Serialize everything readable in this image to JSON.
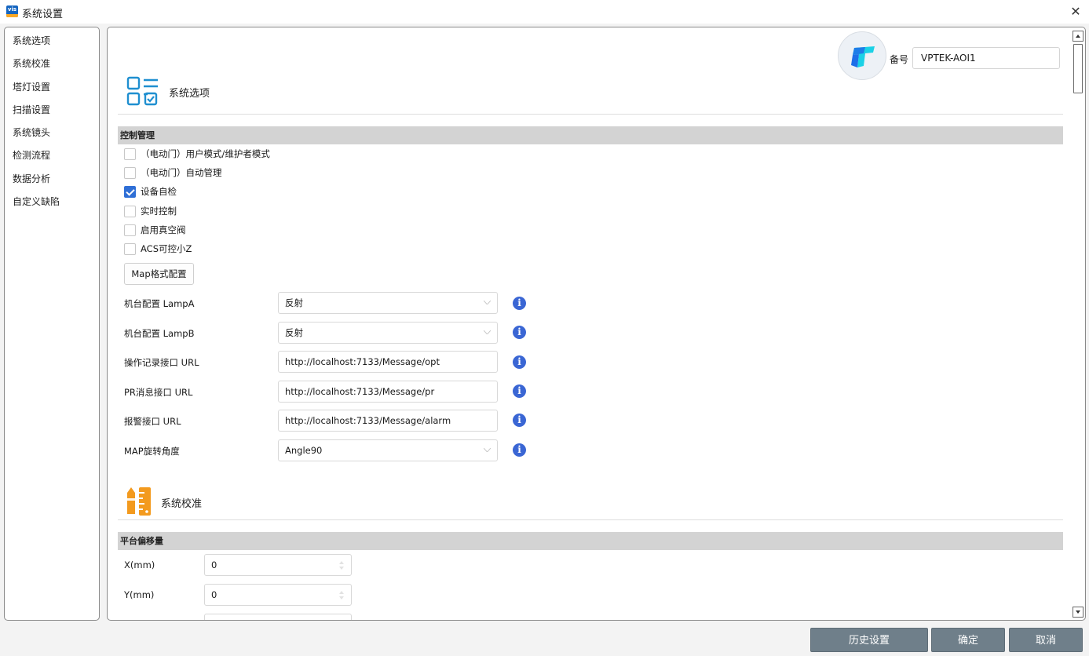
{
  "window": {
    "title": "系统设置",
    "icon_text": "vis",
    "close_glyph": "✕"
  },
  "sidebar": {
    "items": [
      {
        "label": "系统选项"
      },
      {
        "label": "系统校准"
      },
      {
        "label": "塔灯设置"
      },
      {
        "label": "扫描设置"
      },
      {
        "label": "系统镜头"
      },
      {
        "label": "检测流程"
      },
      {
        "label": "数据分析"
      },
      {
        "label": "自定义缺陷"
      }
    ]
  },
  "device": {
    "label": "备号",
    "value": "VPTEK-AOI1"
  },
  "section_options": {
    "title": "系统选项",
    "icon": "checklist-icon",
    "group_title": "控制管理",
    "checkboxes": [
      {
        "label": "（电动门）用户模式/维护者模式",
        "checked": false
      },
      {
        "label": "（电动门）自动管理",
        "checked": false
      },
      {
        "label": "设备自检",
        "checked": true
      },
      {
        "label": "实时控制",
        "checked": false
      },
      {
        "label": "启用真空阀",
        "checked": false
      },
      {
        "label": "ACS可控小Z",
        "checked": false
      }
    ],
    "map_button": "Map格式配置",
    "fields": [
      {
        "label": "机台配置 LampA",
        "value": "反射",
        "type": "select"
      },
      {
        "label": "机台配置 LampB",
        "value": "反射",
        "type": "select"
      },
      {
        "label": "操作记录接口 URL",
        "value": "http://localhost:7133/Message/opt",
        "type": "text"
      },
      {
        "label": "PR消息接口 URL",
        "value": "http://localhost:7133/Message/pr",
        "type": "text"
      },
      {
        "label": "报警接口 URL",
        "value": "http://localhost:7133/Message/alarm",
        "type": "text"
      },
      {
        "label": "MAP旋转角度",
        "value": "Angle90",
        "type": "select"
      }
    ],
    "info_glyph": "i"
  },
  "section_calibration": {
    "title": "系统校准",
    "icon": "ruler-pencil-icon",
    "group_title": "平台偏移量",
    "fields": [
      {
        "label": "X(mm)",
        "value": "0"
      },
      {
        "label": "Y(mm)",
        "value": "0"
      }
    ]
  },
  "footer": {
    "history": "历史设置",
    "ok": "确定",
    "cancel": "取消"
  },
  "colors": {
    "accent": "#2f6fd6",
    "info": "#3a66d4",
    "footer_button": "#6f7f8a",
    "calibration_icon": "#f39a1e",
    "options_icon": "#1f8fd0"
  }
}
